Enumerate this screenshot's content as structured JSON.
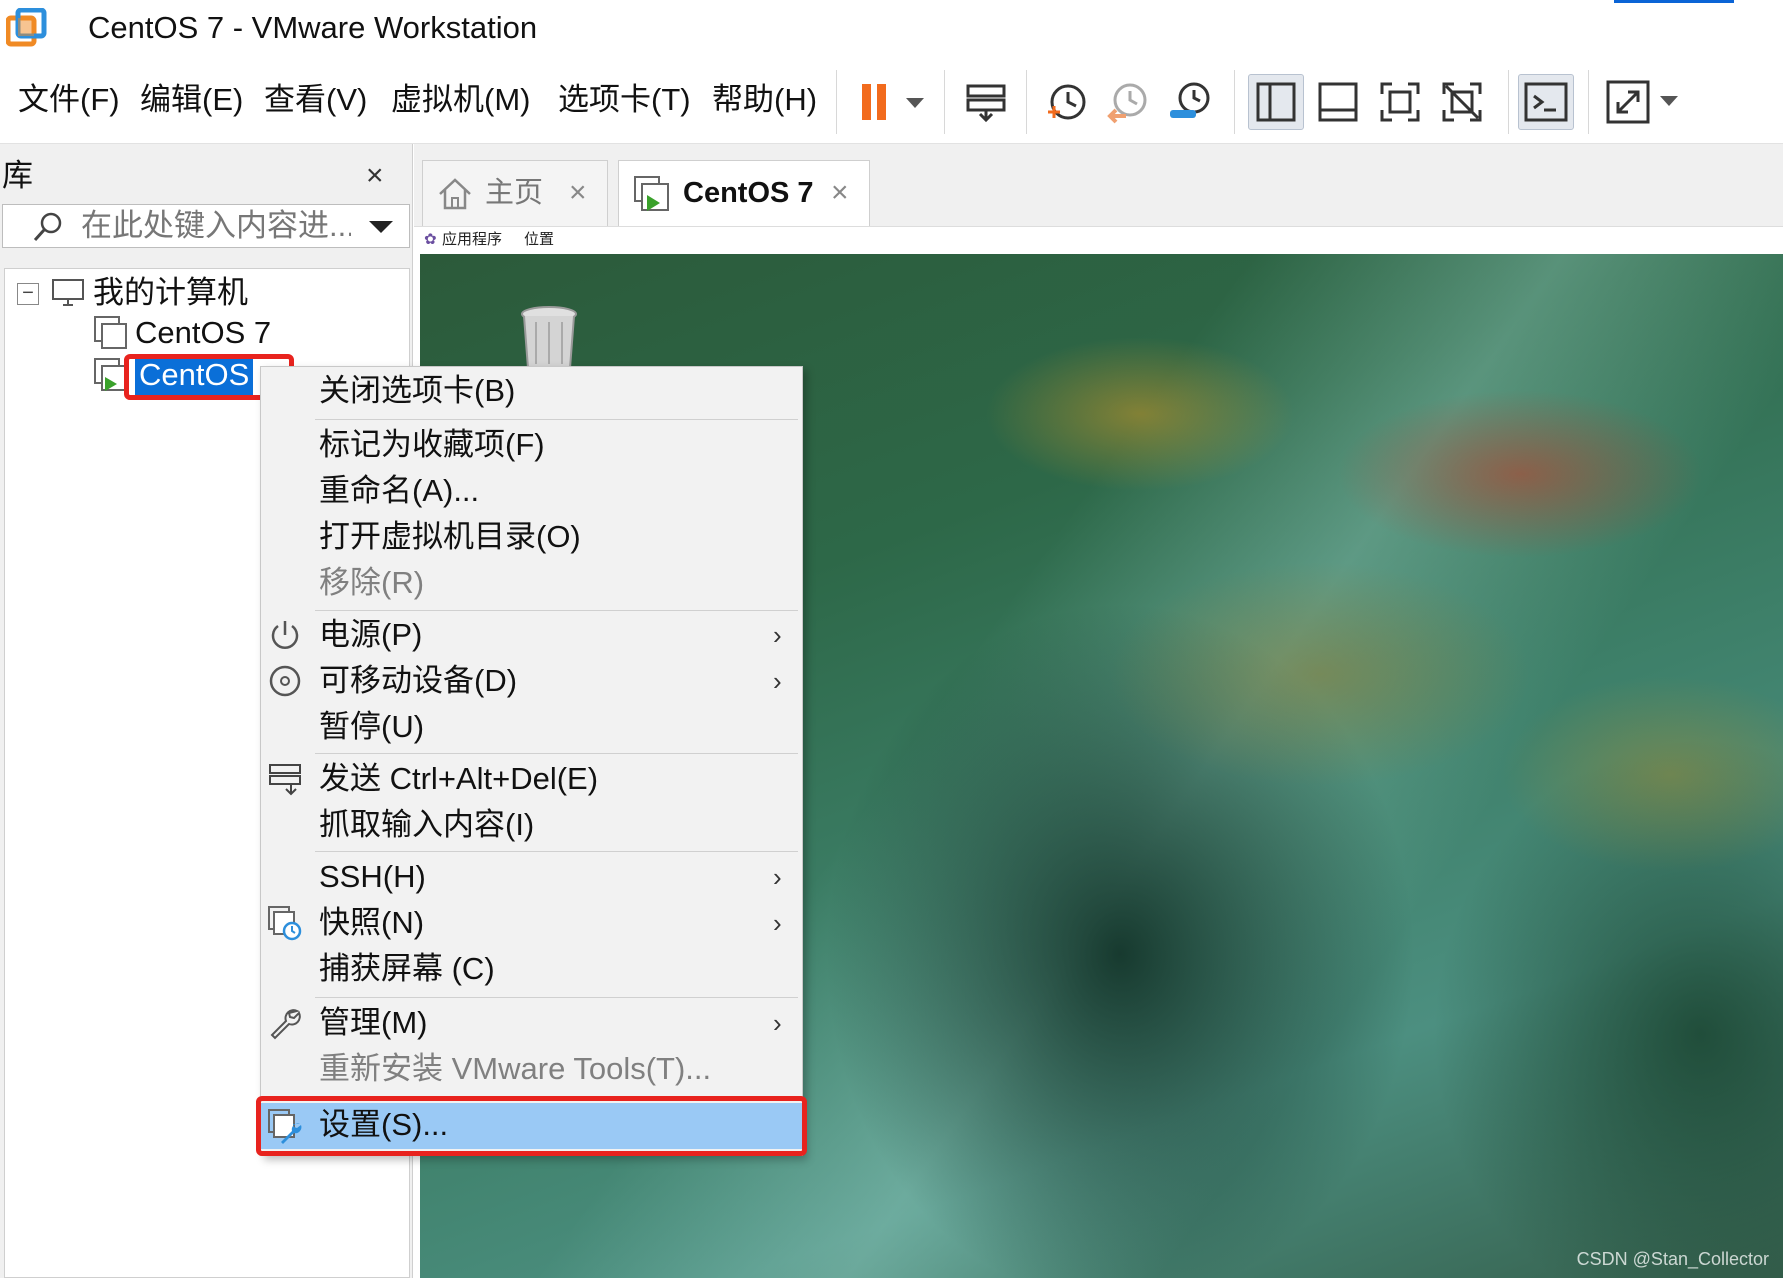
{
  "window": {
    "title": "CentOS 7 - VMware Workstation",
    "accent_color": "#0a64d6"
  },
  "menubar": {
    "items": [
      {
        "label": "文件(F)"
      },
      {
        "label": "编辑(E)"
      },
      {
        "label": "查看(V)"
      },
      {
        "label": "虚拟机(M)"
      },
      {
        "label": "选项卡(T)"
      },
      {
        "label": "帮助(H)"
      }
    ]
  },
  "toolbar": {
    "icons": [
      "pause-icon",
      "send-ctrl-alt-del-icon",
      "snapshot-take-icon",
      "snapshot-revert-icon",
      "snapshot-manager-icon",
      "library-view-icon",
      "thumbnail-bar-icon",
      "fullscreen-icon",
      "unity-icon",
      "console-icon",
      "stretch-icon"
    ],
    "pause_color": "#f26b1d"
  },
  "library": {
    "title": "库",
    "close_label": "×",
    "search_placeholder": "在此处键入内容进...",
    "tree": {
      "root_label": "我的计算机",
      "expander_label": "−",
      "items": [
        {
          "label": "CentOS 7"
        },
        {
          "label": "CentOS",
          "selected": true
        }
      ]
    }
  },
  "tabs": [
    {
      "label": "主页",
      "icon": "home-icon",
      "close_label": "×"
    },
    {
      "label": "CentOS 7",
      "icon": "vm-running-icon",
      "close_label": "×",
      "active": true
    }
  ],
  "vm_bar": {
    "apps_label": "应用程序",
    "places_label": "位置"
  },
  "desktop": {
    "watermark": "CSDN @Stan_Collector"
  },
  "context_menu": {
    "items": [
      {
        "label": "关闭选项卡(B)"
      },
      {
        "label": "标记为收藏项(F)"
      },
      {
        "label": "重命名(A)..."
      },
      {
        "label": "打开虚拟机目录(O)"
      },
      {
        "label": "移除(R)",
        "disabled": true
      },
      {
        "label": "电源(P)",
        "icon": "power-icon",
        "submenu": true
      },
      {
        "label": "可移动设备(D)",
        "icon": "cd-icon",
        "submenu": true
      },
      {
        "label": "暂停(U)"
      },
      {
        "label": "发送 Ctrl+Alt+Del(E)",
        "icon": "send-keys-icon"
      },
      {
        "label": "抓取输入内容(I)"
      },
      {
        "label": "SSH(H)",
        "submenu": true
      },
      {
        "label": "快照(N)",
        "icon": "snapshot-icon",
        "submenu": true
      },
      {
        "label": "捕获屏幕 (C)"
      },
      {
        "label": "管理(M)",
        "icon": "wrench-icon",
        "submenu": true
      },
      {
        "label": "重新安装 VMware Tools(T)...",
        "disabled": true
      },
      {
        "label": "设置(S)...",
        "icon": "settings-icon",
        "highlighted": true
      }
    ],
    "submenu_arrow": "›",
    "highlight_color": "#9ac9f5",
    "annotation_color": "#e8231e"
  }
}
